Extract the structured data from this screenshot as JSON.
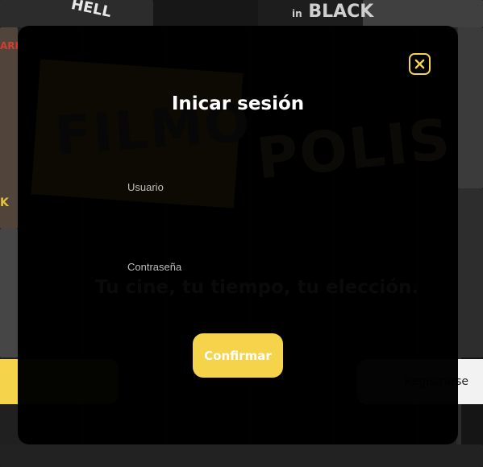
{
  "background": {
    "poster_text_left": "HELL",
    "poster_text_right_top": "in",
    "poster_text_right_main": "BLACK",
    "side_text_red": "ARK",
    "side_text_yellow": "K",
    "register_label": "Registrarse"
  },
  "watermark": {
    "logo_left": "FILMO",
    "logo_right": "POLIS",
    "tagline": "Tu cine, tu tiempo, tu elección."
  },
  "login": {
    "title": "Inicar sesión",
    "username_label": "Usuario",
    "username_value": "",
    "password_label": "Contraseña",
    "password_value": "",
    "confirm_label": "Confirmar",
    "close_icon": "close-x-icon"
  },
  "colors": {
    "accent": "#f5d34a",
    "modal_bg": "#000000",
    "title": "#ffffff",
    "label": "#bdbdbd"
  }
}
